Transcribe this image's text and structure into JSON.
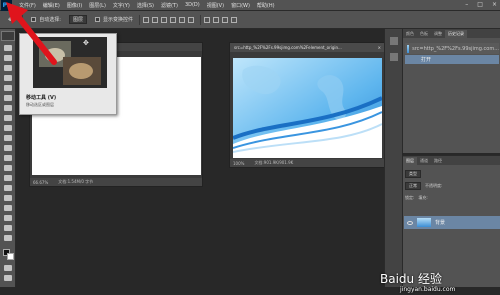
{
  "app": {
    "logo": "Ps"
  },
  "menu": [
    "文件(F)",
    "编辑(E)",
    "图像(I)",
    "图层(L)",
    "文字(Y)",
    "选择(S)",
    "滤镜(T)",
    "3D(D)",
    "视图(V)",
    "窗口(W)",
    "帮助(H)"
  ],
  "window_controls": [
    "–",
    "□",
    "×"
  ],
  "options": {
    "auto_select": "自动选择:",
    "auto_select_value": "图层",
    "show_transform": "显示变换控件"
  },
  "tooltip": {
    "title": "移动工具 (V)",
    "desc": "移动选区或图层"
  },
  "doc1": {
    "zoom": "66.67%",
    "info": "文档:1.54M/0 字节"
  },
  "doc2": {
    "tab_title": "src=http_%2F%2Fs.99sjimg.com%2Felement_origin...",
    "close": "×",
    "zoom": "100%",
    "info": "文档:901.9K/901.9K"
  },
  "history_panel": {
    "tabs": [
      "颜色",
      "色板",
      "调整",
      "历史记录"
    ],
    "items": [
      "src=http_%2F%2Fs.99sjimg.com...",
      "打开"
    ]
  },
  "layers_panel": {
    "tabs": [
      "图层",
      "通道",
      "路径"
    ],
    "kind": "类型",
    "blend": "正常",
    "opacity": "不透明度:",
    "lock": "锁定:",
    "fill": "填充:",
    "layer_name": "背景"
  },
  "watermark": {
    "main": "Baidu 经验",
    "sub": "jingyan.baidu.com"
  },
  "colors": {
    "accent": "#31a8ff",
    "arrow": "#e0141c",
    "selected": "#6b86a4"
  }
}
